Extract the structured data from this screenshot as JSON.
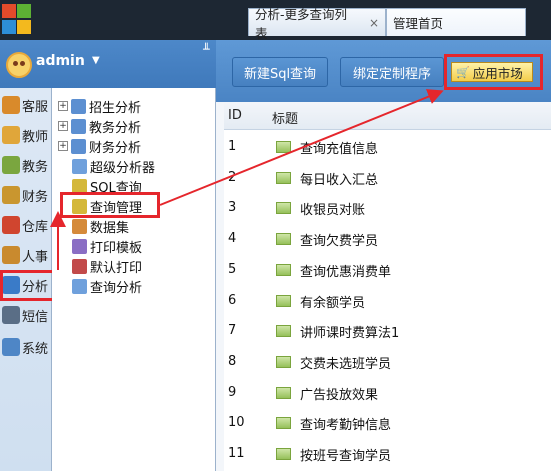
{
  "user": {
    "name": "admin"
  },
  "tabs": [
    {
      "label": "分析-更多查询列表",
      "close": "×"
    },
    {
      "label": "管理首页"
    }
  ],
  "nav": [
    {
      "label": "客服",
      "color": "#d98a2b"
    },
    {
      "label": "教师",
      "color": "#e0a63a"
    },
    {
      "label": "教务",
      "color": "#7aa63f"
    },
    {
      "label": "财务",
      "color": "#c9962f"
    },
    {
      "label": "仓库",
      "color": "#d0452f"
    },
    {
      "label": "人事",
      "color": "#c98a2e"
    },
    {
      "label": "分析",
      "color": "#3a7bc8"
    },
    {
      "label": "短信",
      "color": "#5a6e86"
    },
    {
      "label": "系统",
      "color": "#4e86c6"
    }
  ],
  "tree": [
    {
      "label": "招生分析",
      "expandable": true,
      "color": "#5c8fd1"
    },
    {
      "label": "教务分析",
      "expandable": true,
      "color": "#5c8fd1"
    },
    {
      "label": "财务分析",
      "expandable": true,
      "color": "#5c8fd1"
    },
    {
      "label": "超级分析器",
      "expandable": false,
      "color": "#6fa0dc"
    },
    {
      "label": "SQL查询",
      "expandable": false,
      "color": "#d4b83a"
    },
    {
      "label": "查询管理",
      "expandable": false,
      "color": "#d4b83a"
    },
    {
      "label": "数据集",
      "expandable": false,
      "color": "#d58a3a"
    },
    {
      "label": "打印模板",
      "expandable": false,
      "color": "#8a6ec4"
    },
    {
      "label": "默认打印",
      "expandable": false,
      "color": "#c24a4a"
    },
    {
      "label": "查询分析",
      "expandable": false,
      "color": "#6fa0dc"
    }
  ],
  "toolbar": {
    "new_sql": "新建Sql查询",
    "bind_program": "绑定定制程序",
    "app_market": "应用市场"
  },
  "grid": {
    "headers": {
      "id": "ID",
      "title": "标题"
    },
    "rows": [
      {
        "id": "1",
        "title": "查询充值信息"
      },
      {
        "id": "2",
        "title": "每日收入汇总"
      },
      {
        "id": "3",
        "title": "收银员对账"
      },
      {
        "id": "4",
        "title": "查询欠费学员"
      },
      {
        "id": "5",
        "title": "查询优惠消费单"
      },
      {
        "id": "6",
        "title": "有余额学员"
      },
      {
        "id": "7",
        "title": "讲师课时费算法1"
      },
      {
        "id": "8",
        "title": "交费未选班学员"
      },
      {
        "id": "9",
        "title": "广告投放效果"
      },
      {
        "id": "10",
        "title": "查询考勤钟信息"
      },
      {
        "id": "11",
        "title": "按班号查询学员"
      }
    ]
  },
  "colors": {
    "highlight": "#e5262c",
    "toolbar": "#4a84c4",
    "topbar": "#1d2733"
  }
}
